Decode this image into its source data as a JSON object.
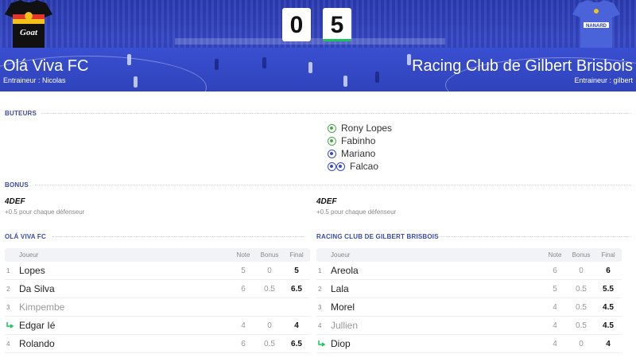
{
  "match": {
    "home_team": "Olá Viva FC",
    "away_team": "Racing Club de Gilbert Brisbois",
    "home_coach": "Entraineur : Nicolas",
    "away_coach": "Entraineur : gilbert",
    "home_score": "0",
    "away_score": "5",
    "home_jersey_text": "Goat",
    "away_jersey_text": "NANARD"
  },
  "scorers": {
    "title": "BUTEURS",
    "items": [
      {
        "name": "Rony Lopes",
        "icon": "goal-ball-icon"
      },
      {
        "name": "Fabinho",
        "icon": "goal-ball-icon"
      },
      {
        "name": "Mariano",
        "icon": "goal-ball-icon"
      },
      {
        "name": "Falcao",
        "icon": "double-goal-ball-icon"
      }
    ]
  },
  "bonus": {
    "title": "BONUS",
    "home": {
      "name": "4DEF",
      "desc": "+0.5 pour chaque défenseur"
    },
    "away": {
      "name": "4DEF",
      "desc": "+0.5 pour chaque défenseur"
    }
  },
  "home_table": {
    "title": "OLÁ VIVA FC",
    "headers": {
      "player": "Joueur",
      "note": "Note",
      "bonus": "Bonus",
      "final": "Final"
    },
    "rows": [
      {
        "num": "1",
        "name": "Lopes",
        "note": "5",
        "bonus": "0",
        "final": "5"
      },
      {
        "num": "2",
        "name": "Da Silva",
        "note": "6",
        "bonus": "0.5",
        "final": "6.5"
      },
      {
        "num": "3",
        "name": "Kimpembe",
        "note": "",
        "bonus": "",
        "final": ""
      },
      {
        "num": "",
        "name": "Edgar Ié",
        "note": "4",
        "bonus": "0",
        "final": "4"
      },
      {
        "num": "4",
        "name": "Rolando",
        "note": "6",
        "bonus": "0.5",
        "final": "6.5"
      }
    ]
  },
  "away_table": {
    "title": "RACING CLUB DE GILBERT BRISBOIS",
    "headers": {
      "player": "Joueur",
      "note": "Note",
      "bonus": "Bonus",
      "final": "Final"
    },
    "rows": [
      {
        "num": "1",
        "name": "Areola",
        "note": "6",
        "bonus": "0",
        "final": "6"
      },
      {
        "num": "2",
        "name": "Lala",
        "note": "5",
        "bonus": "0.5",
        "final": "5.5"
      },
      {
        "num": "3",
        "name": "Morel",
        "note": "4",
        "bonus": "0.5",
        "final": "4.5"
      },
      {
        "num": "4",
        "name": "Jullien",
        "note": "4",
        "bonus": "0.5",
        "final": "4.5"
      },
      {
        "num": "",
        "name": "Diop",
        "note": "4",
        "bonus": "0",
        "final": "4"
      }
    ]
  },
  "colors": {
    "accent": "#3a4aa8",
    "header_bg": "#2f43bc",
    "sub_green": "#19c45e"
  }
}
